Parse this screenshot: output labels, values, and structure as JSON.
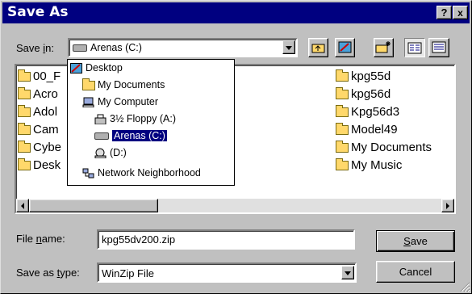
{
  "dialog": {
    "title": "Save As",
    "help_label": "?",
    "close_label": "x"
  },
  "save_in": {
    "label_pre": "Save ",
    "label_u": "i",
    "label_post": "n:",
    "value": "Arenas (C:)"
  },
  "toolbar": {
    "up_icon": "up-folder-icon",
    "desktop_icon": "desktop-icon",
    "new_folder_icon": "new-folder-icon",
    "list_icon": "list-view-icon",
    "details_icon": "details-view-icon"
  },
  "dropdown_tree": [
    {
      "label": "Desktop",
      "icon": "desktop-icon",
      "selected": false
    },
    {
      "label": "My Documents",
      "icon": "my-documents-icon",
      "selected": false
    },
    {
      "label": "My Computer",
      "icon": "my-computer-icon",
      "selected": false
    },
    {
      "label": "3½ Floppy (A:)",
      "icon": "floppy-icon",
      "selected": false
    },
    {
      "label": "Arenas (C:)",
      "icon": "hard-drive-icon",
      "selected": true
    },
    {
      "label": "(D:)",
      "icon": "cd-drive-icon",
      "selected": false
    },
    {
      "label": "Network Neighborhood",
      "icon": "network-icon",
      "selected": false
    }
  ],
  "files_left": [
    "00_F",
    "Acro",
    "Adol",
    "Cam",
    "Cybe",
    "Desk"
  ],
  "files_right": [
    "kpg55d",
    "kpg56d",
    "Kpg56d3",
    "Model49",
    "My Documents",
    "My Music"
  ],
  "file_name": {
    "label_pre": "File ",
    "label_u": "n",
    "label_post": "ame:",
    "value": "kpg55dv200.zip"
  },
  "save_type": {
    "label_pre": "Save as ",
    "label_u": "t",
    "label_post": "ype:",
    "value": "WinZip File"
  },
  "buttons": {
    "save_u": "S",
    "save_rest": "ave",
    "cancel": "Cancel"
  }
}
